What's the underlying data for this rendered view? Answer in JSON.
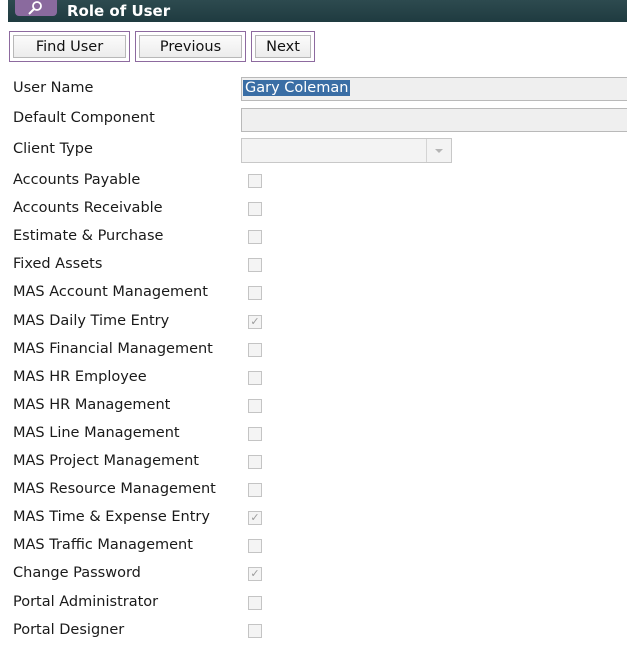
{
  "window": {
    "title": "Role of User",
    "icon": "search-icon"
  },
  "toolbar": {
    "find_user": "Find User",
    "previous": "Previous",
    "next": "Next"
  },
  "form": {
    "user_name": {
      "label": "User Name",
      "value": "Gary Coleman"
    },
    "default_component": {
      "label": "Default Component",
      "value": ""
    },
    "client_type": {
      "label": "Client Type",
      "value": ""
    }
  },
  "roles": [
    {
      "label": "Accounts Payable",
      "checked": false
    },
    {
      "label": "Accounts Receivable",
      "checked": false
    },
    {
      "label": "Estimate & Purchase",
      "checked": false
    },
    {
      "label": "Fixed Assets",
      "checked": false
    },
    {
      "label": "MAS Account Management",
      "checked": false
    },
    {
      "label": "MAS Daily Time Entry",
      "checked": true
    },
    {
      "label": "MAS Financial Management",
      "checked": false
    },
    {
      "label": "MAS HR Employee",
      "checked": false
    },
    {
      "label": "MAS HR Management",
      "checked": false
    },
    {
      "label": "MAS Line Management",
      "checked": false
    },
    {
      "label": "MAS Project Management",
      "checked": false
    },
    {
      "label": "MAS Resource Management",
      "checked": false
    },
    {
      "label": "MAS Time & Expense Entry",
      "checked": true
    },
    {
      "label": "MAS Traffic Management",
      "checked": false
    },
    {
      "label": "Change Password",
      "checked": true
    },
    {
      "label": "Portal Administrator",
      "checked": false
    },
    {
      "label": "Portal Designer",
      "checked": false
    }
  ],
  "colors": {
    "titlebar": "#1f3b40",
    "accent": "#8d6a9f",
    "selection": "#3a6ea5"
  }
}
